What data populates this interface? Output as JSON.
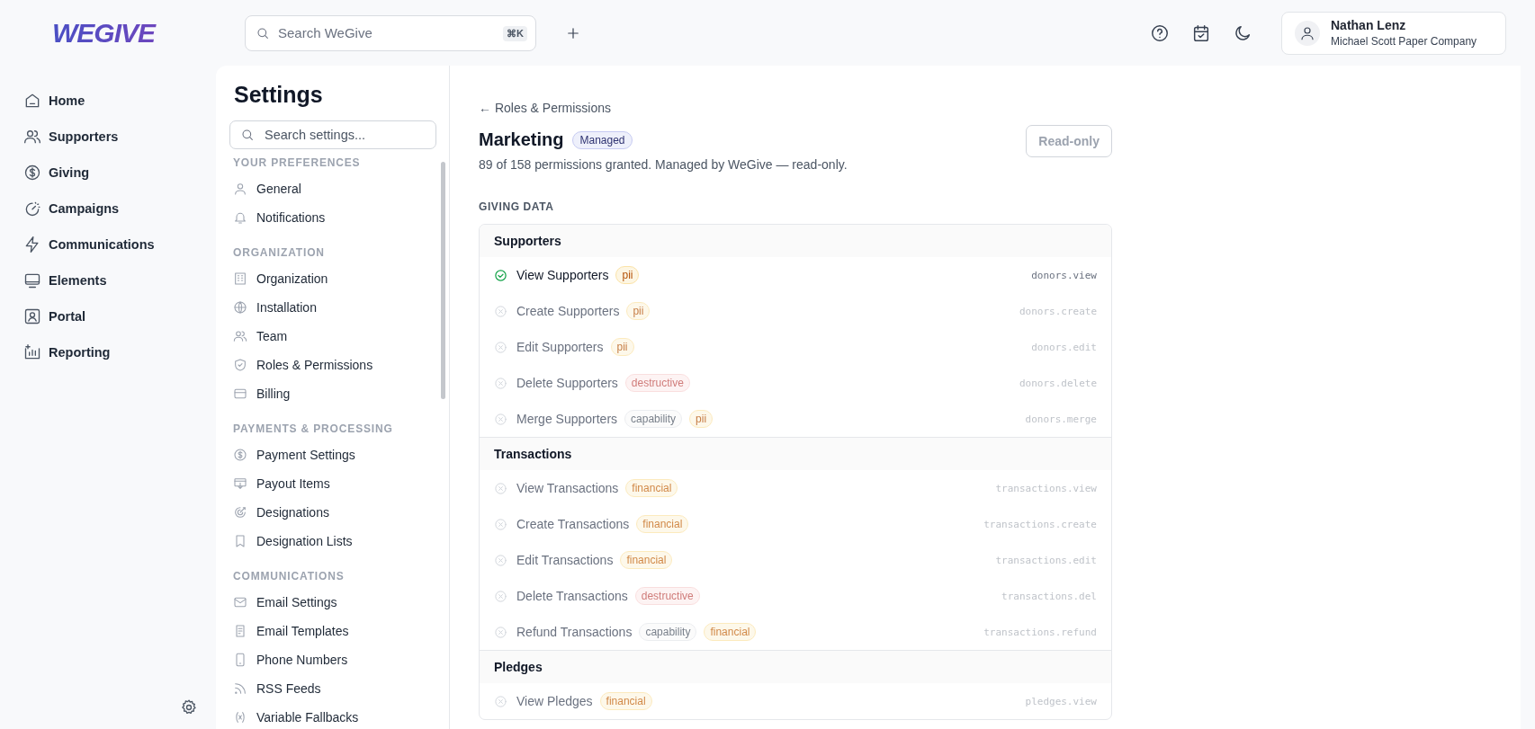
{
  "brand": "WEGIVE",
  "search": {
    "placeholder": "Search WeGive",
    "shortcut": "⌘K"
  },
  "user": {
    "name": "Nathan Lenz",
    "org": "Michael Scott Paper Company"
  },
  "nav": [
    {
      "label": "Home",
      "kind": "home"
    },
    {
      "label": "Supporters",
      "kind": "users"
    },
    {
      "label": "Giving",
      "kind": "dollar"
    },
    {
      "label": "Campaigns",
      "kind": "gauge"
    },
    {
      "label": "Communications",
      "kind": "bolt"
    },
    {
      "label": "Elements",
      "kind": "monitor"
    },
    {
      "label": "Portal",
      "kind": "portal"
    },
    {
      "label": "Reporting",
      "kind": "chart"
    }
  ],
  "settings": {
    "title": "Settings",
    "search_placeholder": "Search settings...",
    "sections": [
      {
        "title": "YOUR PREFERENCES",
        "items": [
          {
            "label": "General",
            "kind": "user"
          },
          {
            "label": "Notifications",
            "kind": "bell"
          }
        ]
      },
      {
        "title": "ORGANIZATION",
        "items": [
          {
            "label": "Organization",
            "kind": "building"
          },
          {
            "label": "Installation",
            "kind": "globe"
          },
          {
            "label": "Team",
            "kind": "users"
          },
          {
            "label": "Roles & Permissions",
            "kind": "shield"
          },
          {
            "label": "Billing",
            "kind": "card"
          }
        ]
      },
      {
        "title": "PAYMENTS & PROCESSING",
        "items": [
          {
            "label": "Payment Settings",
            "kind": "dollar"
          },
          {
            "label": "Payout Items",
            "kind": "payout"
          },
          {
            "label": "Designations",
            "kind": "target"
          },
          {
            "label": "Designation Lists",
            "kind": "bookmark"
          }
        ]
      },
      {
        "title": "COMMUNICATIONS",
        "items": [
          {
            "label": "Email Settings",
            "kind": "mail"
          },
          {
            "label": "Email Templates",
            "kind": "doc"
          },
          {
            "label": "Phone Numbers",
            "kind": "phone"
          },
          {
            "label": "RSS Feeds",
            "kind": "rss"
          },
          {
            "label": "Variable Fallbacks",
            "kind": "variable"
          }
        ]
      }
    ]
  },
  "page": {
    "back": "← Roles & Permissions",
    "role": "Marketing",
    "badge": "Managed",
    "summary": "89 of 158 permissions granted. Managed by WeGive — read-only.",
    "action": {
      "label": "Read-only",
      "disabled": true
    },
    "category": "GIVING DATA",
    "groups": [
      {
        "name": "Supporters",
        "permissions": [
          {
            "label": "View Supporters",
            "granted": true,
            "tags": [
              {
                "label": "pii",
                "kind": "pii"
              }
            ],
            "key": "donors.view"
          },
          {
            "label": "Create Supporters",
            "granted": false,
            "tags": [
              {
                "label": "pii",
                "kind": "pii"
              }
            ],
            "key": "donors.create"
          },
          {
            "label": "Edit Supporters",
            "granted": false,
            "tags": [
              {
                "label": "pii",
                "kind": "pii"
              }
            ],
            "key": "donors.edit"
          },
          {
            "label": "Delete Supporters",
            "granted": false,
            "tags": [
              {
                "label": "destructive",
                "kind": "destructive"
              }
            ],
            "key": "donors.delete"
          },
          {
            "label": "Merge Supporters",
            "granted": false,
            "tags": [
              {
                "label": "capability",
                "kind": "capability"
              },
              {
                "label": "pii",
                "kind": "pii"
              }
            ],
            "key": "donors.merge"
          }
        ]
      },
      {
        "name": "Transactions",
        "permissions": [
          {
            "label": "View Transactions",
            "granted": false,
            "tags": [
              {
                "label": "financial",
                "kind": "financial"
              }
            ],
            "key": "transactions.view"
          },
          {
            "label": "Create Transactions",
            "granted": false,
            "tags": [
              {
                "label": "financial",
                "kind": "financial"
              }
            ],
            "key": "transactions.create"
          },
          {
            "label": "Edit Transactions",
            "granted": false,
            "tags": [
              {
                "label": "financial",
                "kind": "financial"
              }
            ],
            "key": "transactions.edit"
          },
          {
            "label": "Delete Transactions",
            "granted": false,
            "tags": [
              {
                "label": "destructive",
                "kind": "destructive"
              }
            ],
            "key": "transactions.del"
          },
          {
            "label": "Refund Transactions",
            "granted": false,
            "tags": [
              {
                "label": "capability",
                "kind": "capability"
              },
              {
                "label": "financial",
                "kind": "financial"
              }
            ],
            "key": "transactions.refund"
          }
        ]
      },
      {
        "name": "Pledges",
        "permissions": [
          {
            "label": "View Pledges",
            "granted": false,
            "tags": [
              {
                "label": "financial",
                "kind": "financial"
              }
            ],
            "key": "pledges.view"
          }
        ]
      }
    ]
  }
}
